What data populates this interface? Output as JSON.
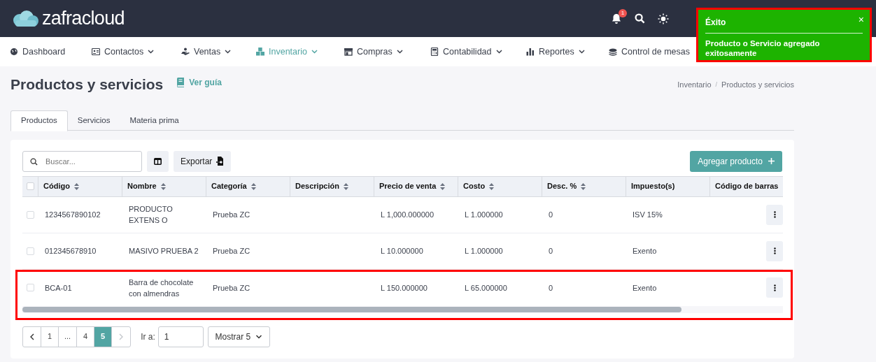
{
  "header": {
    "logo": "**zafra**cloud",
    "notification_count": "1"
  },
  "nav": [
    {
      "label": "Dashboard",
      "dropdown": false,
      "selected": false
    },
    {
      "label": "Contactos",
      "dropdown": true,
      "selected": false
    },
    {
      "label": "Ventas",
      "dropdown": true,
      "selected": false
    },
    {
      "label": "Inventario",
      "dropdown": true,
      "selected": true
    },
    {
      "label": "Compras",
      "dropdown": true,
      "selected": false
    },
    {
      "label": "Contabilidad",
      "dropdown": true,
      "selected": false
    },
    {
      "label": "Reportes",
      "dropdown": true,
      "selected": false
    },
    {
      "label": "Control de mesas",
      "dropdown": false,
      "selected": false
    }
  ],
  "toast": {
    "title": "Éxito",
    "message": "Producto o Servicio agregado exitosamente",
    "close": "×",
    "highlighted": true
  },
  "page": {
    "title": "Productos y servicios",
    "guide_link": "Ver guía",
    "breadcrumb": [
      "Inventario",
      "Productos y servicios"
    ],
    "breadcrumb_separator": "/"
  },
  "tabs": [
    {
      "label": "Productos",
      "selected": true
    },
    {
      "label": "Servicios",
      "selected": false
    },
    {
      "label": "Materia prima",
      "selected": false
    }
  ],
  "toolbar": {
    "search_placeholder": "Buscar...",
    "export": "Exportar",
    "add": "Agregar producto"
  },
  "table": {
    "select_all_checked": false,
    "columns": [
      {
        "label": "Código",
        "sortable": true
      },
      {
        "label": "Nombre",
        "sortable": true
      },
      {
        "label": "Categoría",
        "sortable": true
      },
      {
        "label": "Descripción",
        "sortable": true
      },
      {
        "label": "Precio de venta",
        "sortable": true
      },
      {
        "label": "Costo",
        "sortable": true
      },
      {
        "label": "Desc. %",
        "sortable": true
      },
      {
        "label": "Impuesto(s)",
        "sortable": false
      },
      {
        "label": "Código de barras"
      }
    ],
    "rows": [
      {
        "checked": false,
        "highlighted": false,
        "code": "1234567890102",
        "name": "PRODUCTO EXTENS O",
        "category": "Prueba ZC",
        "price": "L 1,000.000000",
        "cost": "L 1.000000",
        "discount": "0",
        "tax": "ISV 15%"
      },
      {
        "checked": false,
        "highlighted": false,
        "code": "012345678910",
        "name": "MASIVO PRUEBA 2",
        "category": "Prueba ZC",
        "price": "L 10.000000",
        "cost": "L 1.000000",
        "discount": "0",
        "tax": "Exento"
      },
      {
        "checked": false,
        "highlighted": true,
        "code": "BCA-01",
        "name": "Barra de chocolate con almendras",
        "category": "Prueba ZC",
        "price": "L 150.000000",
        "cost": "L 65.000000",
        "discount": "0",
        "tax": "Exento"
      }
    ]
  },
  "pagination": {
    "pages": [
      {
        "label": "1",
        "selected": false
      },
      {
        "label": "...",
        "selected": false
      },
      {
        "label": "4",
        "selected": false
      },
      {
        "label": "5",
        "selected": true
      }
    ],
    "next_disabled": true,
    "goto_label": "Ir a:",
    "goto_value": "1",
    "page_size": "Mostrar 5"
  }
}
